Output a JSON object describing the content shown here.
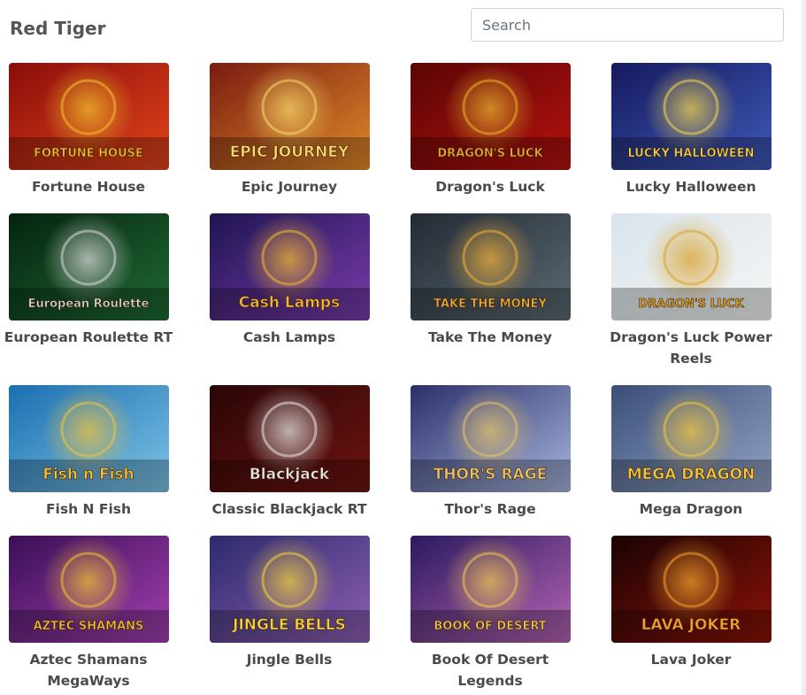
{
  "page": {
    "provider_title": "Red Tiger"
  },
  "search": {
    "placeholder": "Search",
    "value": ""
  },
  "games": [
    {
      "name": "Fortune House",
      "logo": "FORTUNE HOUSE",
      "bg1": "#8a0d0a",
      "bg2": "#e2441a",
      "accent": "#f2c12e"
    },
    {
      "name": "Epic Journey",
      "logo": "EPIC JOURNEY",
      "bg1": "#7a1b10",
      "bg2": "#e08a2a",
      "accent": "#f8d96b"
    },
    {
      "name": "Dragon's Luck",
      "logo": "DRAGON'S LUCK",
      "bg1": "#5a0505",
      "bg2": "#b5120f",
      "accent": "#e7b32c"
    },
    {
      "name": "Lucky Halloween",
      "logo": "LUCKY HALLOWEEN",
      "bg1": "#151a5e",
      "bg2": "#3f59b8",
      "accent": "#f2d54d"
    },
    {
      "name": "European Roulette RT",
      "logo": "European Roulette",
      "bg1": "#05230f",
      "bg2": "#1f6b33",
      "accent": "#d9d9d9"
    },
    {
      "name": "Cash Lamps",
      "logo": "Cash Lamps",
      "bg1": "#1f1450",
      "bg2": "#7a3cae",
      "accent": "#f2b830"
    },
    {
      "name": "Take The Money",
      "logo": "TAKE THE MONEY",
      "bg1": "#232a33",
      "bg2": "#5c6b74",
      "accent": "#f0b03a"
    },
    {
      "name": "Dragon's Luck Power Reels",
      "logo": "DRAGON'S LUCK",
      "bg1": "#d9e4ec",
      "bg2": "#f4f6f4",
      "accent": "#d9a22a"
    },
    {
      "name": "Fish N Fish",
      "logo": "Fish n Fish",
      "bg1": "#1a6fb0",
      "bg2": "#7ec3e6",
      "accent": "#f2c23d"
    },
    {
      "name": "Classic Blackjack RT",
      "logo": "Blackjack",
      "bg1": "#2a0606",
      "bg2": "#6e1410",
      "accent": "#e6e6e6"
    },
    {
      "name": "Thor's Rage",
      "logo": "THOR'S RAGE",
      "bg1": "#2b2f6a",
      "bg2": "#a7b7dd",
      "accent": "#e6c36a"
    },
    {
      "name": "Mega Dragon",
      "logo": "MEGA DRAGON",
      "bg1": "#3a4e79",
      "bg2": "#93a4c4",
      "accent": "#f3c73e"
    },
    {
      "name": "Aztec Shamans MegaWays",
      "logo": "AZTEC SHAMANS",
      "bg1": "#3a0f55",
      "bg2": "#a33fb0",
      "accent": "#f2c232"
    },
    {
      "name": "Jingle Bells",
      "logo": "JINGLE BELLS",
      "bg1": "#2c2a6c",
      "bg2": "#8d5fb4",
      "accent": "#f2d23b"
    },
    {
      "name": "Book Of Desert Legends",
      "logo": "BOOK OF DESERT",
      "bg1": "#2b1a5e",
      "bg2": "#b463b3",
      "accent": "#f0c850"
    },
    {
      "name": "Lava Joker",
      "logo": "LAVA JOKER",
      "bg1": "#1a0303",
      "bg2": "#8c1207",
      "accent": "#f2a12c"
    }
  ]
}
